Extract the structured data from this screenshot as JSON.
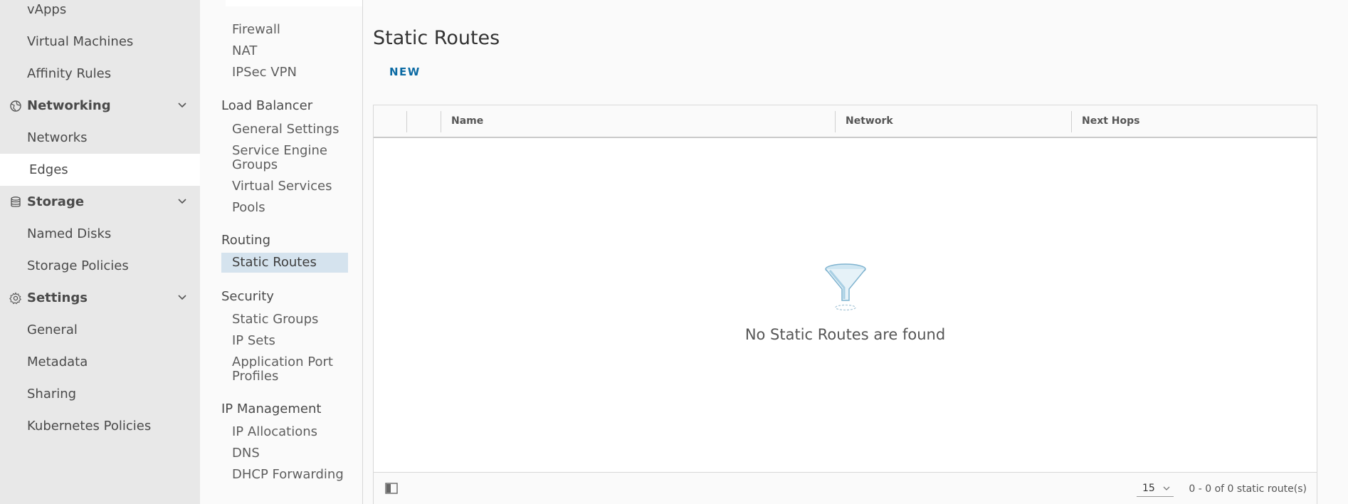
{
  "leftnav": {
    "items": [
      {
        "label": "vApps"
      },
      {
        "label": "Virtual Machines"
      },
      {
        "label": "Affinity Rules"
      }
    ],
    "networking": {
      "label": "Networking",
      "icon": "globe-icon",
      "items": [
        {
          "label": "Networks"
        },
        {
          "label": "Edges"
        }
      ]
    },
    "storage": {
      "label": "Storage",
      "icon": "database-icon",
      "items": [
        {
          "label": "Named Disks"
        },
        {
          "label": "Storage Policies"
        }
      ]
    },
    "settings": {
      "label": "Settings",
      "icon": "gear-icon",
      "items": [
        {
          "label": "General"
        },
        {
          "label": "Metadata"
        },
        {
          "label": "Sharing"
        },
        {
          "label": "Kubernetes Policies"
        }
      ]
    },
    "active": "Edges"
  },
  "subnav": {
    "top_items": [
      "Firewall",
      "NAT",
      "IPSec VPN"
    ],
    "load_balancer": {
      "heading": "Load Balancer",
      "items": [
        "General Settings",
        "Service Engine Groups",
        "Virtual Services",
        "Pools"
      ]
    },
    "routing": {
      "heading": "Routing",
      "items": [
        "Static Routes"
      ]
    },
    "security": {
      "heading": "Security",
      "items": [
        "Static Groups",
        "IP Sets",
        "Application Port Profiles"
      ]
    },
    "ip_management": {
      "heading": "IP Management",
      "items": [
        "IP Allocations",
        "DNS",
        "DHCP Forwarding"
      ]
    },
    "active": "Static Routes"
  },
  "main": {
    "title": "Static Routes",
    "new_label": "NEW",
    "columns": [
      "Name",
      "Network",
      "Next Hops"
    ],
    "empty_message": "No Static Routes are found",
    "page_size": "15",
    "page_count": "0 - 0 of 0 static route(s)"
  },
  "colors": {
    "accent": "#0b6aa3",
    "active_subnav_bg": "#d5e3ee",
    "leftnav_bg": "#e8e8e8"
  }
}
